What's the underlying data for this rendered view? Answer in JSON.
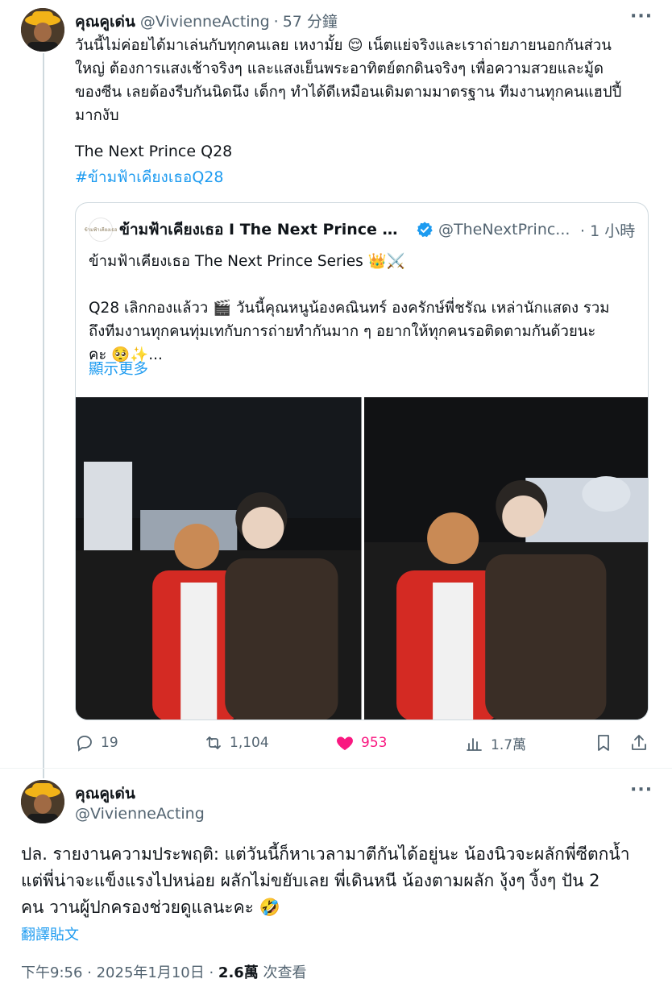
{
  "tweet": {
    "display_name": "คุณคูเด่น",
    "handle": "@VivienneActing",
    "time": "57 分鐘",
    "text": "วันนี้ไม่ค่อยได้มาเล่นกับทุกคนเลย เหงามั้ย 😌 เน็ตแย่จริงและเราถ่ายภายนอกกันส่วน\nใหญ่ ต้องการแสงเช้าจริงๆ และแสงเย็นพระอาทิตย์ตกดินจริงๆ เพื่อความสวยและมู้ด\nของซีน เลยต้องรีบกันนิดนึง เด็กๆ ทำได้ดีเหมือนเดิมตามมาตรฐาน ทีมงานทุกคนแฮปปี้\nมากงับ",
    "title_line": "The Next Prince Q28",
    "hashtag": "#ข้ามฟ้าเคียงเธอQ28",
    "more_icon": "more-dots-icon"
  },
  "quote": {
    "display_name": "ข้ามฟ้าเคียงเธอ I The Next Prince S...",
    "handle": "@TheNextPrinc...",
    "time": "· 1 小時",
    "avatar_text": "ข้ามฟ้าเคียงเธอ",
    "text": "ข้ามฟ้าเคียงเธอ The Next Prince Series 👑⚔️\n\nQ28 เลิกกองแล้วว 🎬 วันนี้คุณหนูน้องคณินทร์ องครักษ์พี่ชรัณ เหล่านักแสดง รวม\nถึงทีมงานทุกคนทุ่มเทกับการถ่ายทำกันมาก ๆ อยากให้ทุกคนรอติดตามกันด้วยนะ\nคะ 🥺✨...",
    "show_more": "顯示更多"
  },
  "actions": {
    "replies": "19",
    "retweets": "1,104",
    "likes": "953",
    "views": "1.7萬"
  },
  "reply": {
    "display_name": "คุณคูเด่น",
    "handle": "@VivienneActing",
    "text": "ปล. รายงานความประพฤติ: แต่วันนี้ก็หาเวลามาตีกันได้อยู่นะ น้องนิวจะผลักพี่ซีตกน้ำ\nแต่พี่น่าจะแข็งแรงไปหน่อย ผลักไม่ขยับเลย พี่เดินหนี น้องตามผลัก งุ้งๆ งิ้งๆ ปัน 2\nคน วานผู้ปกครองช่วยดูแลนะคะ 🤣",
    "translate": "翻譯貼文",
    "time": "下午9:56 · 2025年1月10日 · ",
    "views_count": "2.6萬",
    "views_label": " 次查看"
  },
  "colors": {
    "accent": "#1d9bf0",
    "like": "#f91880",
    "muted": "#536471"
  }
}
